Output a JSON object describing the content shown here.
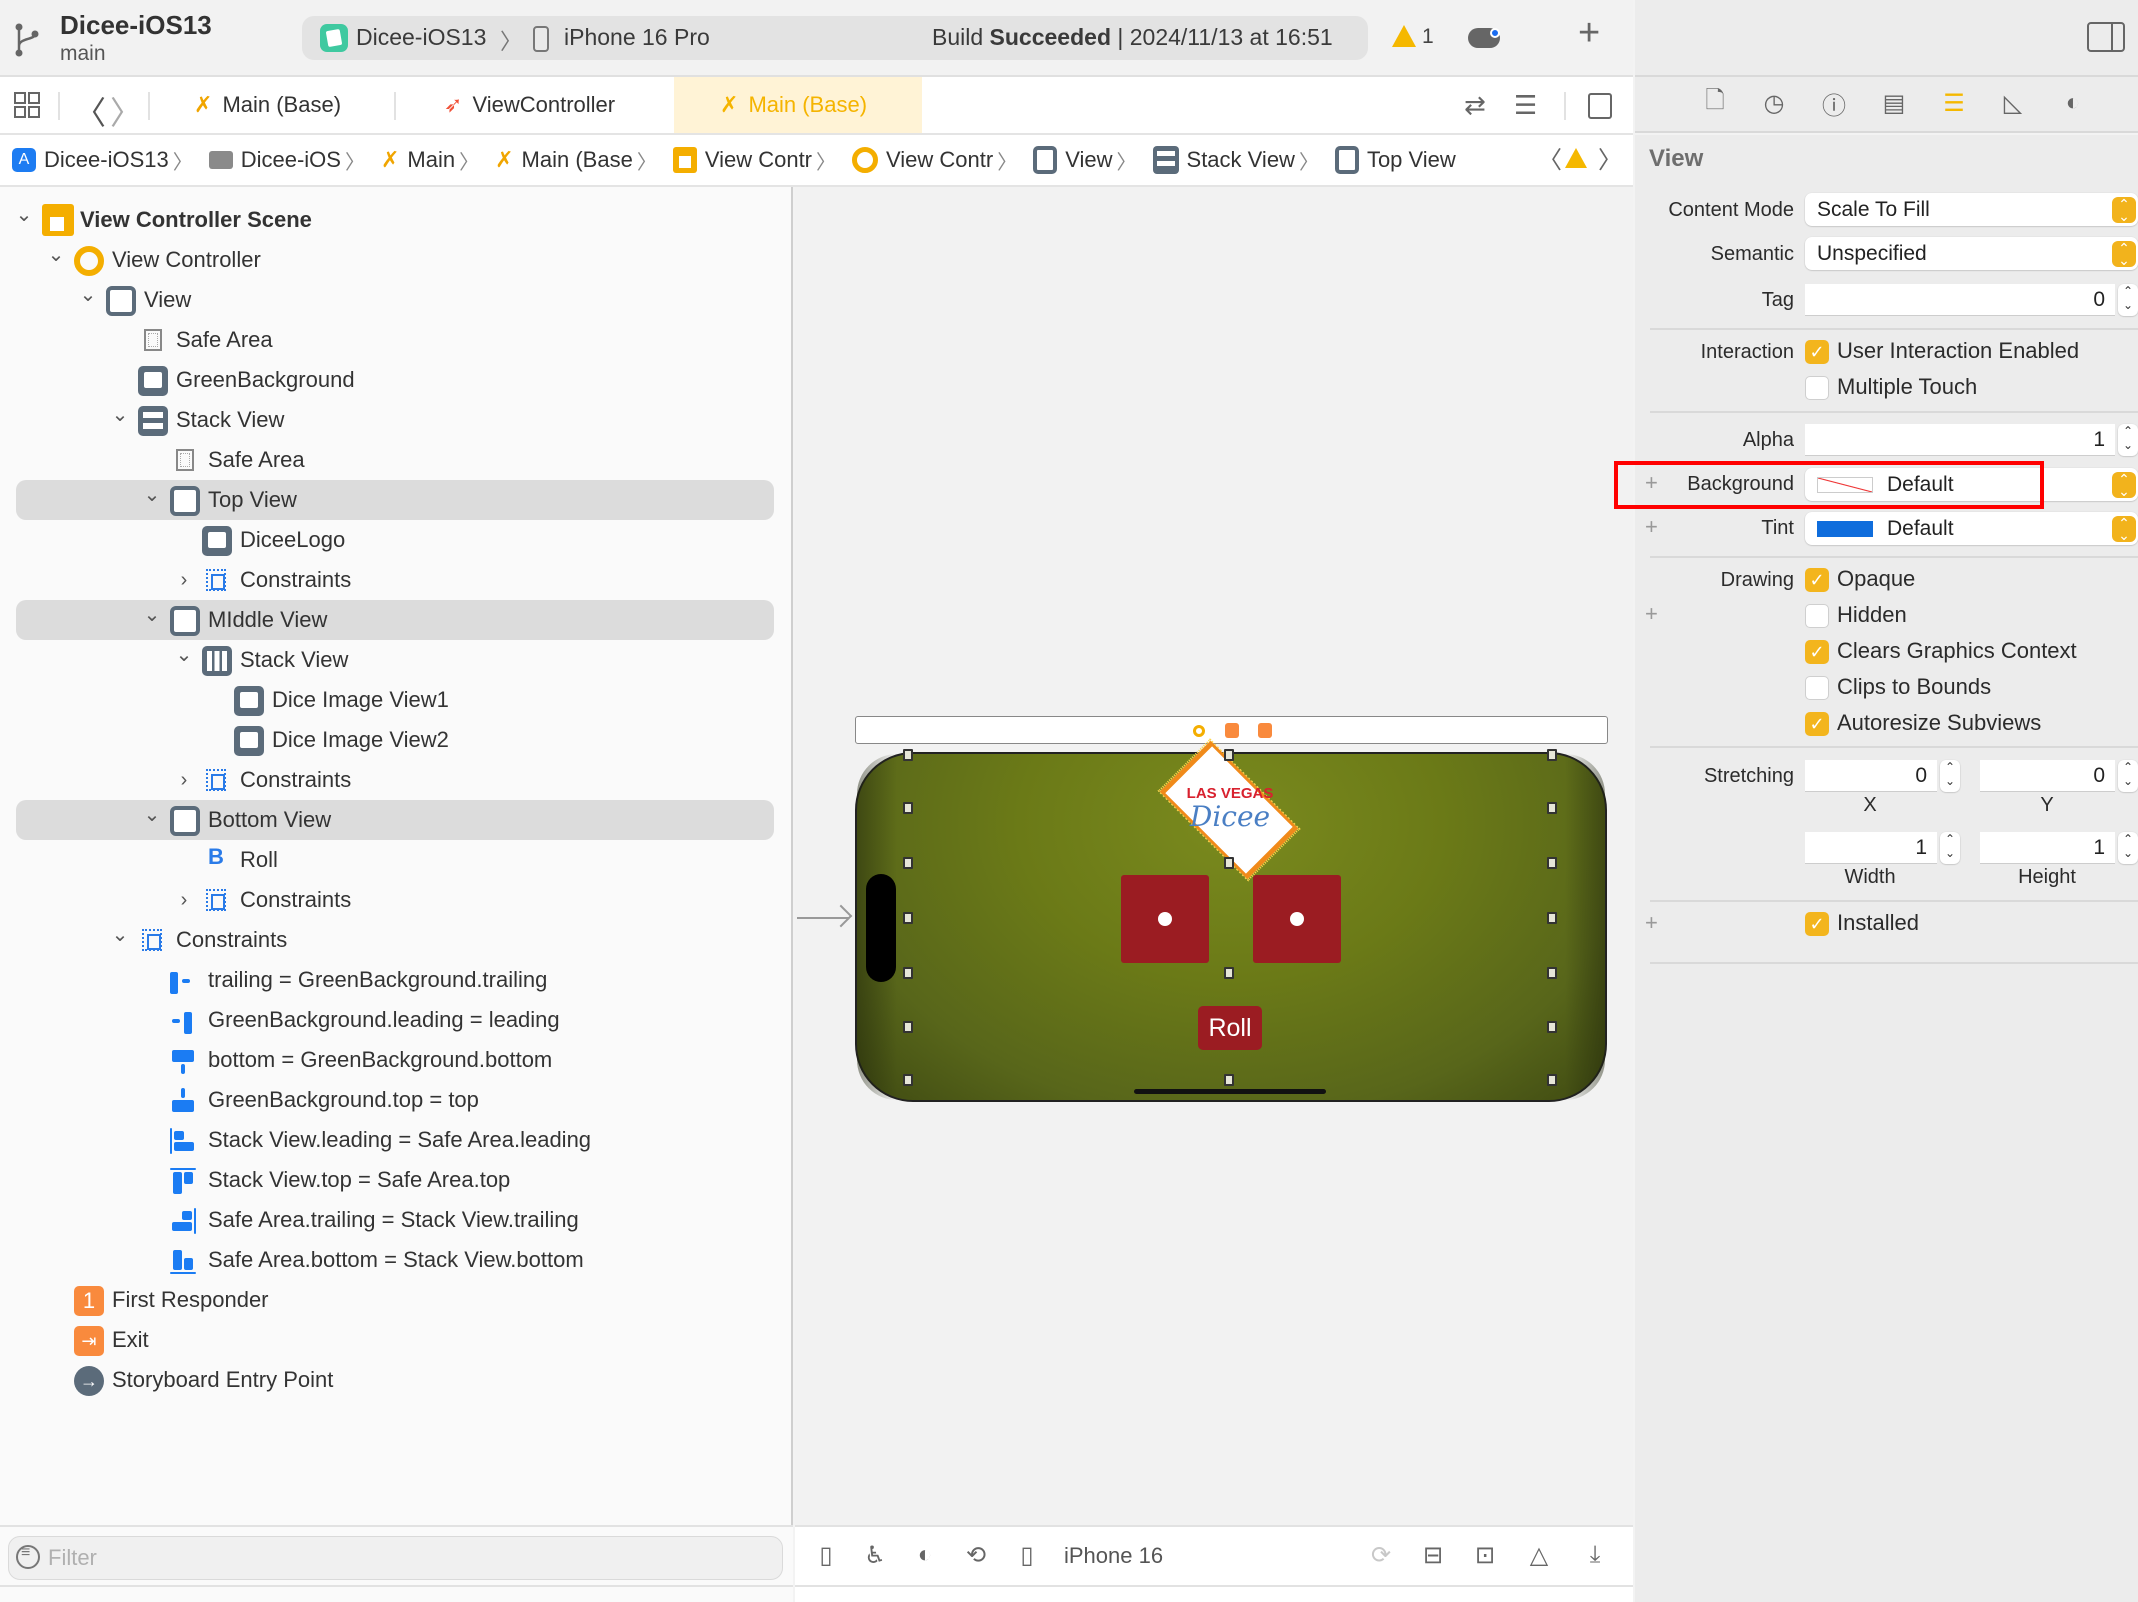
{
  "toolbar": {
    "project_title": "Dicee-iOS13",
    "branch": "main",
    "scheme": "Dicee-iOS13",
    "scheme_separator": "〉",
    "device": "iPhone 16 Pro",
    "build_status_prefix": "Build ",
    "build_status_bold": "Succeeded",
    "build_status_suffix": " | 2024/11/13 at 16:51",
    "warning_count": "1",
    "add_label": "+"
  },
  "tabs": [
    {
      "label": "Main (Base)",
      "icon": "storyboard-icon",
      "active": false
    },
    {
      "label": "ViewController",
      "icon": "swift-icon",
      "active": false
    },
    {
      "label": "Main (Base)",
      "icon": "storyboard-icon",
      "active": true
    }
  ],
  "nav": {
    "back": "〈",
    "forward": "〉"
  },
  "breadcrumb": [
    {
      "label": "Dicee-iOS13",
      "icon": "app-icon"
    },
    {
      "label": "Dicee-iOS",
      "icon": "folder-icon"
    },
    {
      "label": "Main",
      "icon": "storyboard-icon"
    },
    {
      "label": "Main (Base",
      "icon": "storyboard-icon"
    },
    {
      "label": "View Contr",
      "icon": "scene-icon"
    },
    {
      "label": "View Contr",
      "icon": "view-controller-icon"
    },
    {
      "label": "View",
      "icon": "view-icon"
    },
    {
      "label": "Stack View",
      "icon": "stack-view-icon"
    },
    {
      "label": "Top View",
      "icon": "view-icon"
    }
  ],
  "breadcrumb_sep": "〉",
  "outline": [
    {
      "label": "View Controller Scene",
      "icon": "scene-icon",
      "disclosure": "open",
      "level": 0,
      "bold": true
    },
    {
      "label": "View Controller",
      "icon": "view-controller-icon",
      "disclosure": "open",
      "level": 1
    },
    {
      "label": "View",
      "icon": "view-icon",
      "disclosure": "open",
      "level": 2
    },
    {
      "label": "Safe Area",
      "icon": "safe-area-icon",
      "disclosure": "none",
      "level": 3
    },
    {
      "label": "GreenBackground",
      "icon": "image-view-icon",
      "disclosure": "none",
      "level": 3
    },
    {
      "label": "Stack View",
      "icon": "stack-view-icon",
      "disclosure": "open",
      "level": 3
    },
    {
      "label": "Safe Area",
      "icon": "safe-area-icon",
      "disclosure": "none",
      "level": 4
    },
    {
      "label": "Top View",
      "icon": "view-icon",
      "disclosure": "open",
      "level": 4,
      "selected": true
    },
    {
      "label": "DiceeLogo",
      "icon": "image-view-icon",
      "disclosure": "none",
      "level": 5
    },
    {
      "label": "Constraints",
      "icon": "constraints-icon",
      "disclosure": "closed",
      "level": 5
    },
    {
      "label": "MIddle View",
      "icon": "view-icon",
      "disclosure": "open",
      "level": 4,
      "selected": true
    },
    {
      "label": "Stack View",
      "icon": "horizontal-stack-icon",
      "disclosure": "open",
      "level": 5
    },
    {
      "label": "Dice Image View1",
      "icon": "image-view-icon",
      "disclosure": "none",
      "level": 6
    },
    {
      "label": "Dice Image View2",
      "icon": "image-view-icon",
      "disclosure": "none",
      "level": 6
    },
    {
      "label": "Constraints",
      "icon": "constraints-icon",
      "disclosure": "closed",
      "level": 5
    },
    {
      "label": "Bottom View",
      "icon": "view-icon",
      "disclosure": "open",
      "level": 4,
      "selected": true
    },
    {
      "label": "Roll",
      "icon": "button-icon",
      "disclosure": "none",
      "level": 5
    },
    {
      "label": "Constraints",
      "icon": "constraints-icon",
      "disclosure": "closed",
      "level": 5
    },
    {
      "label": "Constraints",
      "icon": "constraints-icon",
      "disclosure": "open",
      "level": 3
    },
    {
      "label": "trailing = GreenBackground.trailing",
      "icon": "trailing-constraint-icon",
      "disclosure": "none",
      "level": 4
    },
    {
      "label": "GreenBackground.leading = leading",
      "icon": "leading-constraint-icon",
      "disclosure": "none",
      "level": 4
    },
    {
      "label": "bottom = GreenBackground.bottom",
      "icon": "bottom-constraint-icon",
      "disclosure": "none",
      "level": 4
    },
    {
      "label": "GreenBackground.top = top",
      "icon": "top-constraint-icon",
      "disclosure": "none",
      "level": 4
    },
    {
      "label": "Stack View.leading = Safe Area.leading",
      "icon": "align-leading-icon",
      "disclosure": "none",
      "level": 4
    },
    {
      "label": "Stack View.top = Safe Area.top",
      "icon": "align-top-icon",
      "disclosure": "none",
      "level": 4
    },
    {
      "label": "Safe Area.trailing = Stack View.trailing",
      "icon": "align-trailing-icon",
      "disclosure": "none",
      "level": 4
    },
    {
      "label": "Safe Area.bottom = Stack View.bottom",
      "icon": "align-bottom-icon",
      "disclosure": "none",
      "level": 4
    },
    {
      "label": "First Responder",
      "icon": "first-responder-icon",
      "disclosure": "none",
      "level": 1
    },
    {
      "label": "Exit",
      "icon": "exit-icon",
      "disclosure": "none",
      "level": 1
    },
    {
      "label": "Storyboard Entry Point",
      "icon": "entry-point-icon",
      "disclosure": "none",
      "level": 1
    }
  ],
  "filter": {
    "placeholder": "Filter",
    "value": ""
  },
  "canvas": {
    "device_label": "iPhone 16",
    "logo_top": "LAS VEGAS",
    "logo_bottom": "Dicee",
    "roll_label": "Roll"
  },
  "inspector": {
    "title": "View",
    "content_mode_label": "Content Mode",
    "content_mode_value": "Scale To Fill",
    "semantic_label": "Semantic",
    "semantic_value": "Unspecified",
    "tag_label": "Tag",
    "tag_value": "0",
    "interaction_label": "Interaction",
    "user_interaction_label": "User Interaction Enabled",
    "user_interaction_checked": true,
    "multiple_touch_label": "Multiple Touch",
    "multiple_touch_checked": false,
    "alpha_label": "Alpha",
    "alpha_value": "1",
    "background_label": "Background",
    "background_value": "Default",
    "tint_label": "Tint",
    "tint_value": "Default",
    "tint_color": "#0f6ddc",
    "drawing_label": "Drawing",
    "opaque_label": "Opaque",
    "opaque_checked": true,
    "hidden_label": "Hidden",
    "hidden_checked": false,
    "clears_label": "Clears Graphics Context",
    "clears_checked": true,
    "clips_label": "Clips to Bounds",
    "clips_checked": false,
    "autoresize_label": "Autoresize Subviews",
    "autoresize_checked": true,
    "stretching_label": "Stretching",
    "stretch_x": "0",
    "stretch_y": "0",
    "stretch_w": "1",
    "stretch_h": "1",
    "x_label": "X",
    "y_label": "Y",
    "width_label": "Width",
    "height_label": "Height",
    "installed_label": "Installed",
    "installed_checked": true,
    "plus": "+",
    "check": "✓"
  },
  "colors": {
    "accent": "#f3b51d",
    "highlight": "#ff0000",
    "selection": "#dcdcdc"
  }
}
